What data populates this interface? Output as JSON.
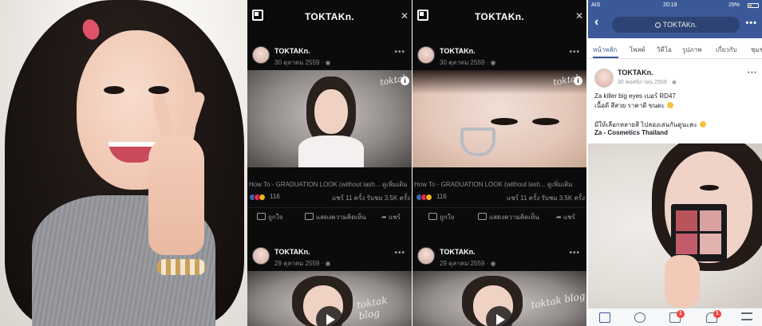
{
  "panels": {
    "video_feed": {
      "title": "TOKTAKn.",
      "posts": [
        {
          "name": "TOKTAKn.",
          "date": "30 ตุลาคม 2559 · ◉",
          "video_title": "How To - GRADUATION LOOK (without lash... ดูเพิ่มเติม",
          "reaction_count": "116",
          "share_stats": "แชร์ 11 ครั้ง  รับชม 3.5K ครั้ง",
          "overlay_logo": "toktak",
          "info": "i"
        },
        {
          "name": "TOKTAKn.",
          "date": "29 ตุลาคม 2559 · ◉",
          "overlay_logo": "toktak blog"
        }
      ],
      "actions": {
        "like": "ถูกใจ",
        "comment": "แสดงความคิดเห็น",
        "share": "แชร์"
      }
    },
    "facebook_post": {
      "status": {
        "carrier": "AIS",
        "time": "20:19",
        "battery": "29%"
      },
      "search_text": "TOKTAKn.",
      "tabs": [
        "หน้าหลัก",
        "โพสต์",
        "วิดีโอ",
        "รูปภาพ",
        "เกี่ยวกับ",
        "ชุมชน"
      ],
      "post": {
        "name": "TOKTAKn.",
        "date": "30 พฤศจิกายน 2559 · ◉",
        "caption_lines": [
          "Za killer big eyes เบอร์ RD47",
          "เนื้อดี สีสวย ราคาดี ขนตะ",
          "",
          "มีให้เลือกหลายสี ไปลองเล่นกันดูนะคะ",
          "Za - Cosmetics Thailand"
        ]
      },
      "bottom_bar": [
        {
          "icon": "news-feed-icon",
          "badge": ""
        },
        {
          "icon": "video-icon",
          "badge": ""
        },
        {
          "icon": "marketplace-icon",
          "badge": "1"
        },
        {
          "icon": "notifications-icon",
          "badge": "1"
        },
        {
          "icon": "menu-icon",
          "badge": ""
        }
      ]
    }
  },
  "colors": {
    "facebook_blue": "#3b5998",
    "dark_bg": "#0b0b0c",
    "badge_red": "#fa3e3e",
    "like_blue": "#4267b2",
    "love_red": "#f0284a",
    "haha_yellow": "#f7b125"
  }
}
